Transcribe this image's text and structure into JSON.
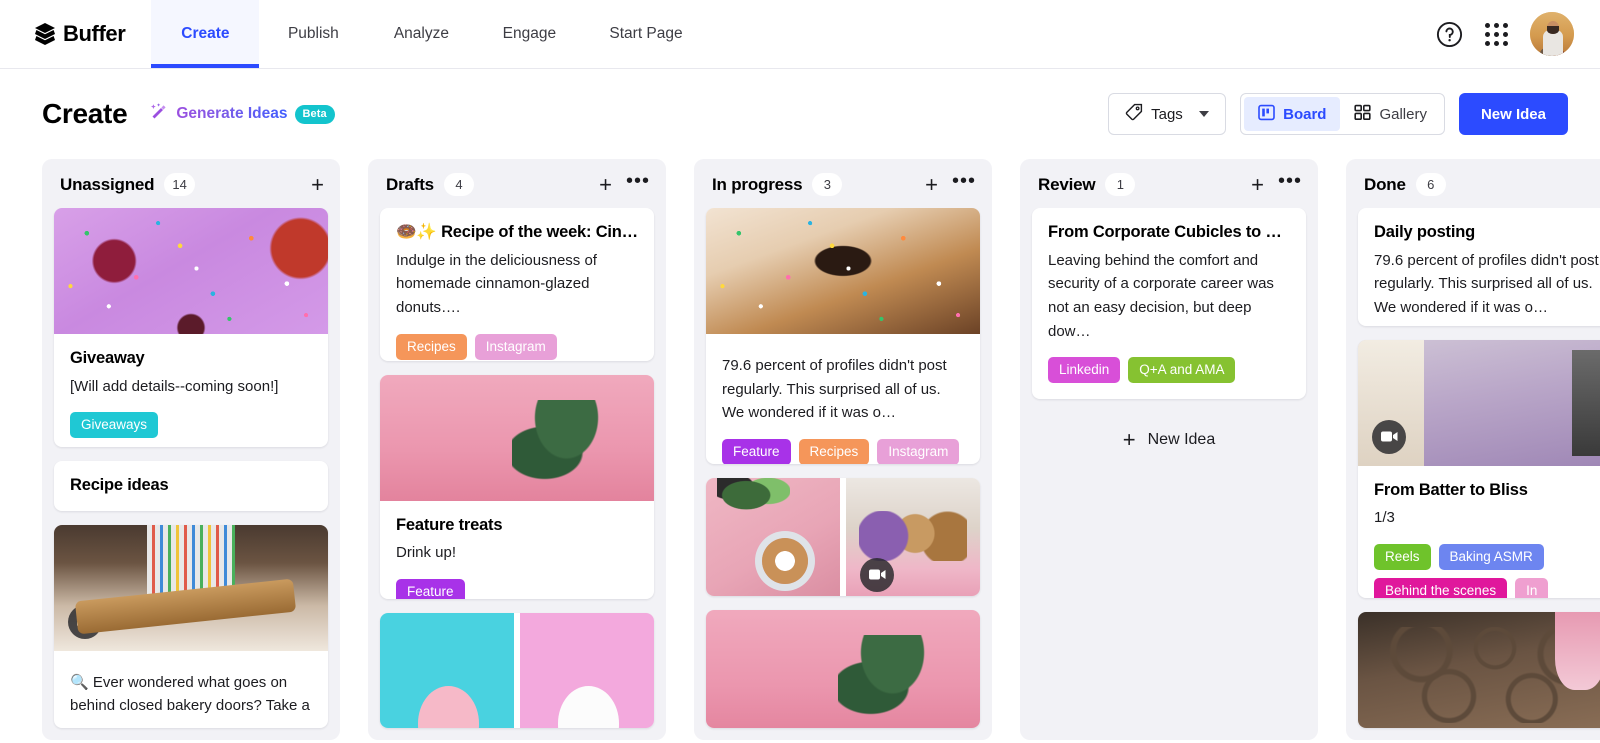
{
  "brand": {
    "name": "Buffer",
    "logo_icon": "buffer-logo-icon"
  },
  "nav": {
    "tabs": [
      {
        "label": "Create",
        "active": true
      },
      {
        "label": "Publish",
        "active": false
      },
      {
        "label": "Analyze",
        "active": false
      },
      {
        "label": "Engage",
        "active": false
      },
      {
        "label": "Start Page",
        "active": false
      }
    ],
    "help_icon": "help-circle-icon",
    "apps_icon": "apps-grid-icon",
    "avatar_icon": "user-avatar"
  },
  "toolbar": {
    "title": "Create",
    "generate_ideas_label": "Generate Ideas",
    "generate_ideas_icon": "magic-wand-icon",
    "beta_badge": "Beta",
    "tags_label": "Tags",
    "tags_icon": "tag-icon",
    "board_label": "Board",
    "board_icon": "board-view-icon",
    "gallery_label": "Gallery",
    "gallery_icon": "gallery-view-icon",
    "new_idea_label": "New Idea",
    "accent_color": "#2c4bff",
    "active_segment": "Board"
  },
  "colors": {
    "tag_giveaways": "#1fc8d4",
    "tag_recipes": "#f5965a",
    "tag_instagram": "#e8a0d8",
    "tag_feature": "#a832e8",
    "tag_linkedin": "#d84fd8",
    "tag_qa": "#86c231",
    "tag_reels": "#6fc32b",
    "tag_baking_asmr": "#6d85f0",
    "tag_behind_scenes": "#e0179c",
    "tag_in": "#ef9fd0"
  },
  "board": {
    "columns": [
      {
        "title": "Unassigned",
        "count": "14",
        "has_menu": false,
        "add_idea_label": null,
        "cards": [
          {
            "media": "img-donut-purple sprinkles",
            "media_name": "purple-sprinkle-donut-image",
            "video": false,
            "title": "Giveaway",
            "text": "[Will add details--coming soon!]",
            "tags": [
              {
                "label": "Giveaways",
                "color": "#1fc8d4"
              }
            ]
          },
          {
            "media": null,
            "title": "Recipe ideas",
            "text": null,
            "tags": []
          },
          {
            "media": "img-bakery",
            "media_name": "bakery-rolling-pin-image",
            "video": true,
            "title": null,
            "text": "🔍 Ever wondered what goes on behind closed bakery doors? Take a",
            "tags": []
          }
        ]
      },
      {
        "title": "Drafts",
        "count": "4",
        "has_menu": true,
        "add_idea_label": null,
        "cards": [
          {
            "media": null,
            "title": "🍩✨ Recipe of the week: Cin…",
            "text": "Indulge in the deliciousness of homemade cinnamon-glazed donuts….",
            "tags": [
              {
                "label": "Recipes",
                "color": "#f5965a"
              },
              {
                "label": "Instagram",
                "color": "#e8a0d8"
              }
            ]
          },
          {
            "media": "img-pinkplant",
            "media_name": "pink-popsicles-image",
            "video": false,
            "title": "Feature treats",
            "text": "Drink up!",
            "tags": [
              {
                "label": "Feature",
                "color": "#a832e8"
              }
            ]
          },
          {
            "media": "split-cyan-pink",
            "media_name": "donuts-on-color-blocks-image",
            "video": false,
            "title": null,
            "text": null,
            "tags": []
          }
        ]
      },
      {
        "title": "In progress",
        "count": "3",
        "has_menu": true,
        "add_idea_label": null,
        "cards": [
          {
            "media": "img-donut-choc",
            "media_name": "chocolate-sprinkle-donut-image",
            "video": false,
            "title": null,
            "text": "79.6 percent of profiles didn't post regularly. This surprised all of us. We wondered if it was o…",
            "tags": [
              {
                "label": "Feature",
                "color": "#a832e8"
              },
              {
                "label": "Recipes",
                "color": "#f5965a"
              },
              {
                "label": "Instagram",
                "color": "#e8a0d8"
              }
            ]
          },
          {
            "media": "pair",
            "media_name": "coffee-and-donut-box-images",
            "video": true,
            "title": null,
            "text": null,
            "tags": []
          },
          {
            "media": "img-pinkplant",
            "media_name": "pink-room-plant-image",
            "video": false,
            "title": null,
            "text": null,
            "tags": []
          }
        ]
      },
      {
        "title": "Review",
        "count": "1",
        "has_menu": true,
        "add_idea_label": "New Idea",
        "cards": [
          {
            "media": null,
            "title": "From Corporate Cubicles to Co…",
            "text": "Leaving behind the comfort and security of a corporate career was not an easy decision, but deep dow…",
            "tags": [
              {
                "label": "Linkedin",
                "color": "#d84fd8"
              },
              {
                "label": "Q+A and AMA",
                "color": "#86c231"
              }
            ]
          }
        ]
      },
      {
        "title": "Done",
        "count": "6",
        "has_menu": false,
        "add_idea_label": null,
        "cards": [
          {
            "media": null,
            "title": "Daily posting",
            "text": "79.6 percent of profiles didn't post regularly. This surprised all of us. We wondered if it was o…",
            "tags": []
          },
          {
            "media": "img-purplebowl",
            "media_name": "baking-mixer-video-image",
            "video": true,
            "title": "From Batter to Bliss",
            "text": "1/3",
            "tags": [
              {
                "label": "Reels",
                "color": "#6fc32b"
              },
              {
                "label": "Baking ASMR",
                "color": "#6d85f0"
              },
              {
                "label": "Behind the scenes",
                "color": "#e0179c"
              },
              {
                "label": "In",
                "color": "#ef9fd0"
              }
            ]
          },
          {
            "media": "img-macaron",
            "media_name": "macaron-piping-image",
            "video": false,
            "title": null,
            "text": null,
            "tags": []
          }
        ]
      }
    ]
  }
}
